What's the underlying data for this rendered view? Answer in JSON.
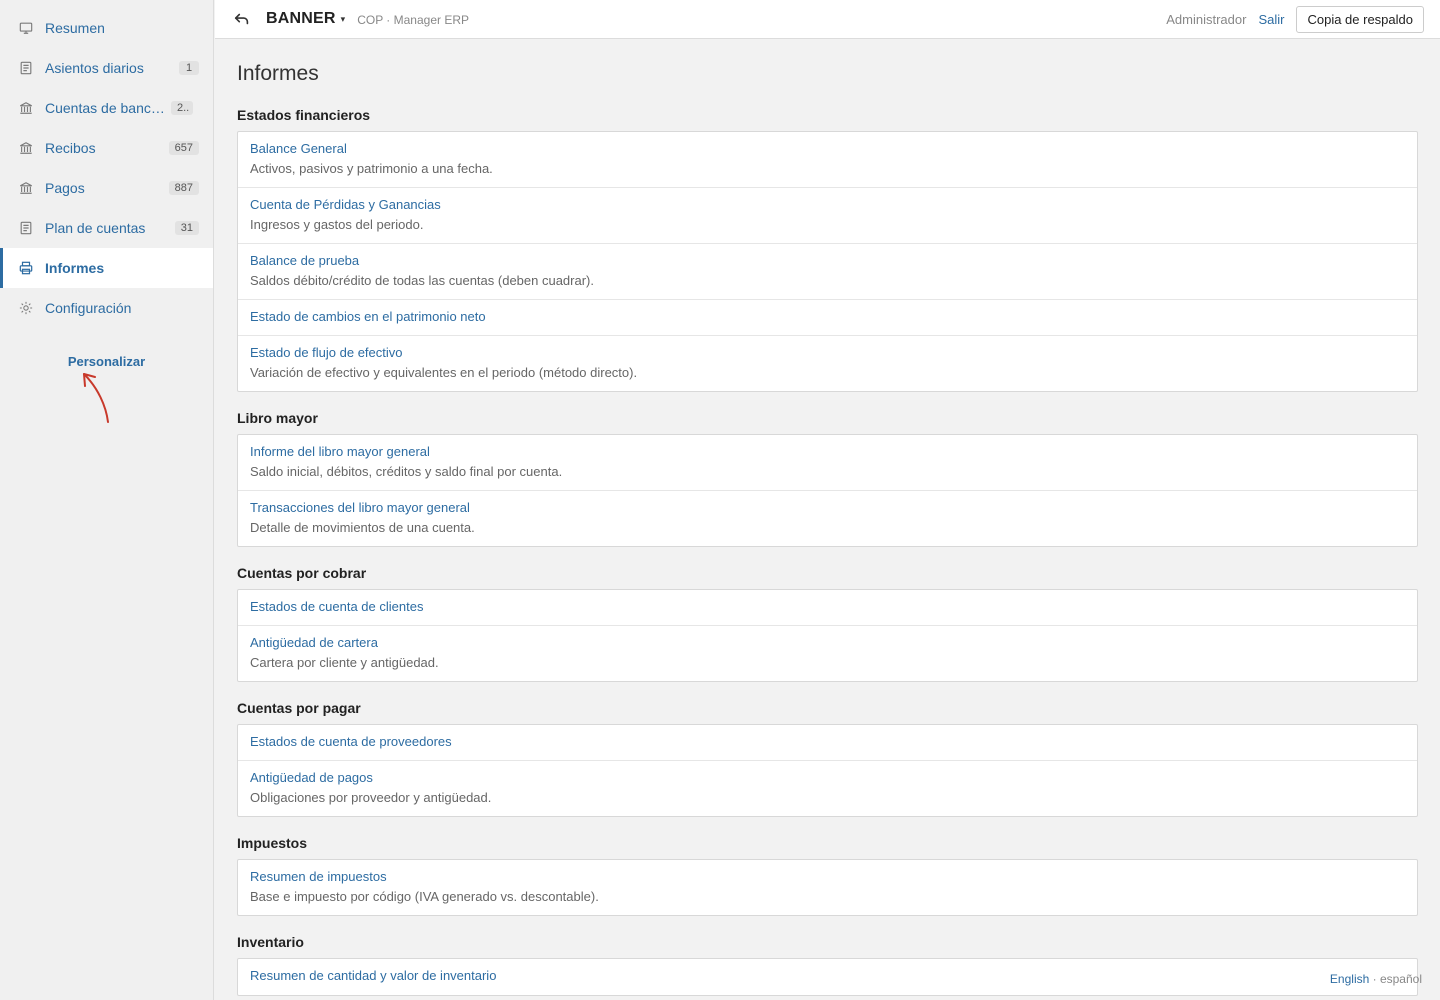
{
  "sidebar": {
    "items": [
      {
        "label": "Resumen",
        "icon": "monitor-icon",
        "badge": ""
      },
      {
        "label": "Asientos diarios",
        "icon": "ledger-icon",
        "badge": "1"
      },
      {
        "label": "Cuentas de bancos",
        "icon": "bank-icon",
        "badge": "2.."
      },
      {
        "label": "Recibos",
        "icon": "bank-icon",
        "badge": "657"
      },
      {
        "label": "Pagos",
        "icon": "bank-icon",
        "badge": "887"
      },
      {
        "label": "Plan de cuentas",
        "icon": "ledger-icon",
        "badge": "31"
      },
      {
        "label": "Informes",
        "icon": "printer-icon",
        "badge": ""
      },
      {
        "label": "Configuración",
        "icon": "gear-icon",
        "badge": ""
      }
    ],
    "customize_label": "Personalizar"
  },
  "header": {
    "company": "BANNER",
    "caret": "▾",
    "subtitle": "COP · Manager ERP",
    "user": "Administrador",
    "logout": "Salir",
    "backup": "Copia de respaldo"
  },
  "main": {
    "title": "Informes",
    "sections": [
      {
        "title": "Estados financieros",
        "reports": [
          {
            "name": "Balance General",
            "desc": "Activos, pasivos y patrimonio a una fecha."
          },
          {
            "name": "Cuenta de Pérdidas y Ganancias",
            "desc": "Ingresos y gastos del periodo."
          },
          {
            "name": "Balance de prueba",
            "desc": "Saldos débito/crédito de todas las cuentas (deben cuadrar)."
          },
          {
            "name": "Estado de cambios en el patrimonio neto",
            "desc": ""
          },
          {
            "name": "Estado de flujo de efectivo",
            "desc": "Variación de efectivo y equivalentes en el periodo (método directo)."
          }
        ]
      },
      {
        "title": "Libro mayor",
        "reports": [
          {
            "name": "Informe del libro mayor general",
            "desc": "Saldo inicial, débitos, créditos y saldo final por cuenta."
          },
          {
            "name": "Transacciones del libro mayor general",
            "desc": "Detalle de movimientos de una cuenta."
          }
        ]
      },
      {
        "title": "Cuentas por cobrar",
        "reports": [
          {
            "name": "Estados de cuenta de clientes",
            "desc": ""
          },
          {
            "name": "Antigüedad de cartera",
            "desc": "Cartera por cliente y antigüedad."
          }
        ]
      },
      {
        "title": "Cuentas por pagar",
        "reports": [
          {
            "name": "Estados de cuenta de proveedores",
            "desc": ""
          },
          {
            "name": "Antigüedad de pagos",
            "desc": "Obligaciones por proveedor y antigüedad."
          }
        ]
      },
      {
        "title": "Impuestos",
        "reports": [
          {
            "name": "Resumen de impuestos",
            "desc": "Base e impuesto por código (IVA generado vs. descontable)."
          }
        ]
      },
      {
        "title": "Inventario",
        "reports": [
          {
            "name": "Resumen de cantidad y valor de inventario",
            "desc": ""
          }
        ]
      }
    ]
  },
  "footer": {
    "lang_en": "English",
    "lang_sep": " · ",
    "lang_es": "español"
  }
}
